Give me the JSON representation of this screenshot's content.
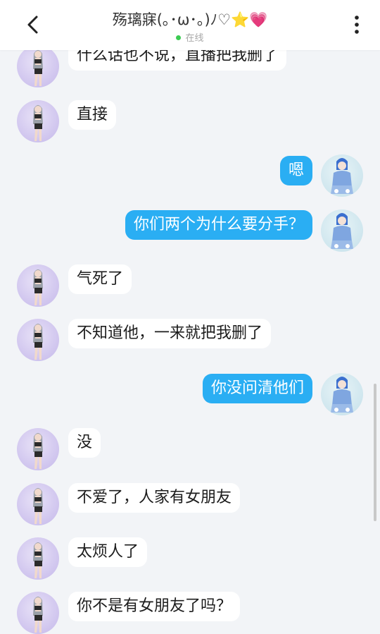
{
  "header": {
    "title": "殇璃寐(｡･ω･｡)ﾉ♡⭐💗",
    "status": "在线"
  },
  "messages": [
    {
      "side": "left",
      "text": "什么话也不说，直播把我删了"
    },
    {
      "side": "left",
      "text": "直接"
    },
    {
      "side": "right",
      "text": "嗯"
    },
    {
      "side": "right",
      "text": "你们两个为什么要分手？"
    },
    {
      "side": "left",
      "text": "气死了"
    },
    {
      "side": "left",
      "text": "不知道他，一来就把我删了"
    },
    {
      "side": "right",
      "text": "你没问清他们"
    },
    {
      "side": "left",
      "text": "没"
    },
    {
      "side": "left",
      "text": "不爱了，人家有女朋友"
    },
    {
      "side": "left",
      "text": "太烦人了"
    },
    {
      "side": "left",
      "text": "你不是有女朋友了吗？"
    }
  ],
  "colors": {
    "outgoing_bubble": "#2aaef3",
    "incoming_bubble": "#ffffff",
    "background": "#f2f4f7",
    "online_dot": "#3ccb52"
  }
}
